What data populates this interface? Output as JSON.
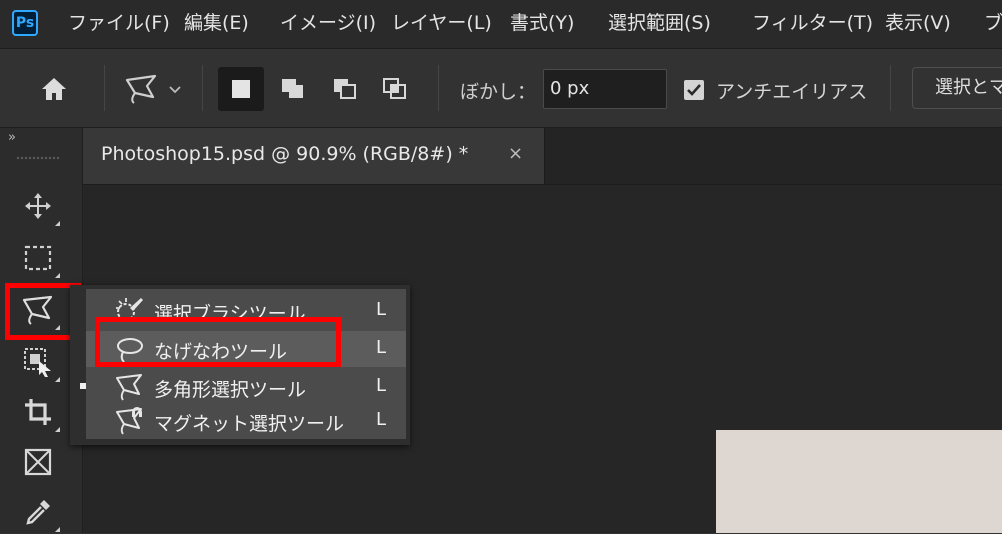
{
  "menubar": {
    "logo": "Ps",
    "items": [
      "ファイル(F)",
      "編集(E)",
      "イメージ(I)",
      "レイヤー(L)",
      "書式(Y)",
      "選択範囲(S)",
      "フィルター(T)",
      "表示(V)",
      "ブ"
    ]
  },
  "options": {
    "home_icon": "home-icon",
    "tool_icon": "lasso-icon",
    "mode_icons": [
      "new-selection-icon",
      "add-to-selection-icon",
      "subtract-from-selection-icon",
      "intersect-selection-icon"
    ],
    "blur_label": "ぼかし：",
    "blur_value": "0 px",
    "antialias_label": "アンチエイリアス",
    "antialias_checked": true,
    "select_button": "選択とマ"
  },
  "toolbar": {
    "collapse": "»",
    "tools": [
      "move-tool",
      "marquee-tool",
      "lasso-tool",
      "object-selection-tool",
      "crop-tool",
      "frame-tool",
      "eyedropper-tool"
    ]
  },
  "tab": {
    "title": "Photoshop15.psd @ 90.9% (RGB/8#) *",
    "close": "×"
  },
  "flyout": {
    "items": [
      {
        "label": "選択ブラシツール",
        "key": "L",
        "icon": "selection-brush-icon"
      },
      {
        "label": "なげなわツール",
        "key": "L",
        "icon": "lasso-icon"
      },
      {
        "label": "多角形選択ツール",
        "key": "L",
        "icon": "polygonal-lasso-icon"
      },
      {
        "label": "マグネット選択ツール",
        "key": "L",
        "icon": "magnetic-lasso-icon"
      }
    ],
    "active_index": 1,
    "current_tool_index": 2
  },
  "colors": {
    "highlight": "#ff0000",
    "ps_blue": "#31a8ff"
  }
}
